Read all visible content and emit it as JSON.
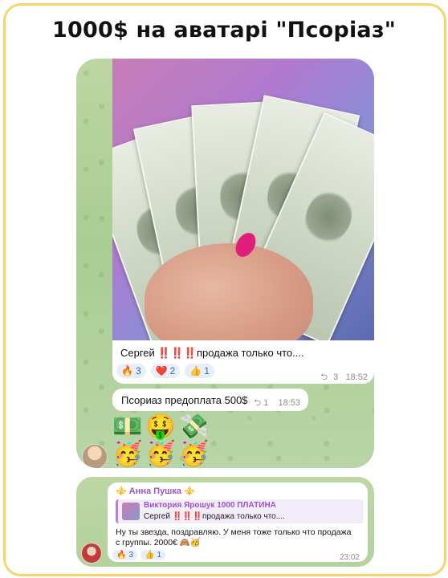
{
  "headline": "1000$ на аватарі \"Псоріаз\"",
  "message1": {
    "caption": "Сергей ‼️‼️‼️продажа только что....",
    "reactions": [
      {
        "emoji": "🔥",
        "count": "3"
      },
      {
        "emoji": "❤️",
        "count": "2"
      },
      {
        "emoji": "👍",
        "count": "1"
      }
    ],
    "replies": "3",
    "time": "18:52"
  },
  "message2": {
    "text": "Псориаз предоплата 500$",
    "replies": "1",
    "time": "18:53"
  },
  "emoji_rows": {
    "row1": [
      "💵",
      "🤑",
      "💸"
    ],
    "row2": [
      "🥳",
      "🥳",
      "🥳"
    ]
  },
  "message3": {
    "sender": "⚜️ Анна Пушка ⚜️",
    "reply_name": "Виктория Ярошук 1000 ПЛАТИНА",
    "reply_text": "Сергей ‼️‼️‼️продажа только что....",
    "text": "Ну ты звезда, поздравляю. У меня тоже только что продажа с группы. 2000€ 🙈🥳",
    "reactions": [
      {
        "emoji": "🔥",
        "count": "3"
      },
      {
        "emoji": "👍",
        "count": "1"
      }
    ],
    "time": "23:02"
  },
  "icons": {
    "reply": "reply-arrow-icon",
    "avatar": "avatar"
  }
}
